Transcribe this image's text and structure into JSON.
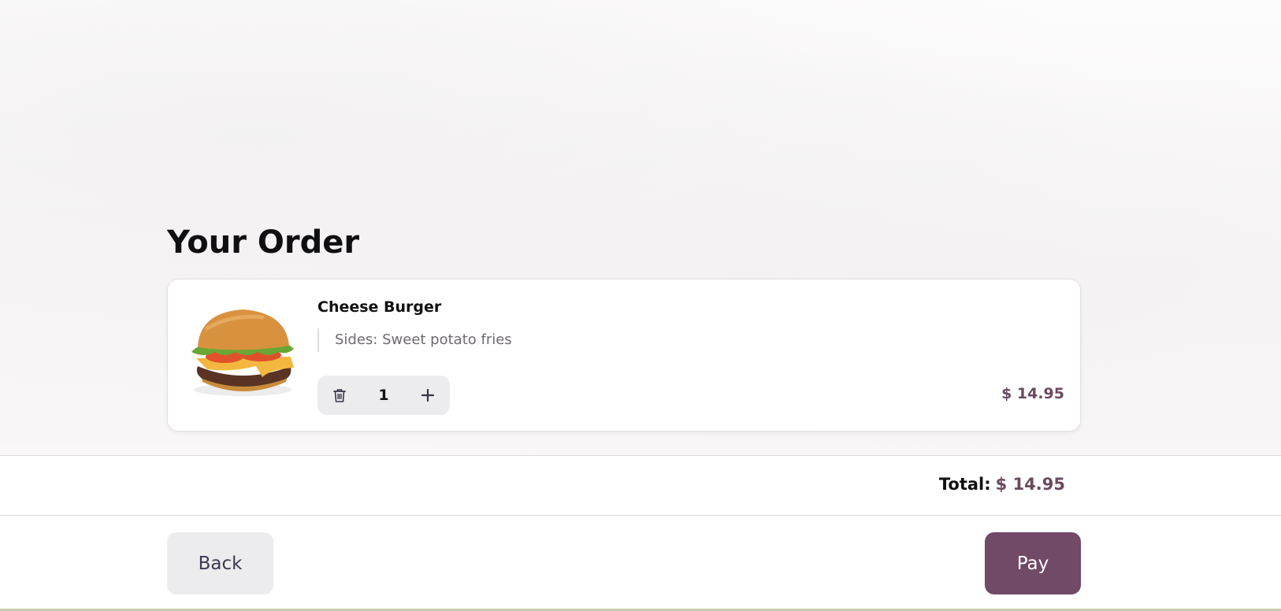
{
  "order": {
    "title": "Your Order",
    "items": [
      {
        "name": "Cheese Burger",
        "modifier": "Sides: Sweet potato fries",
        "quantity": "1",
        "price": "$ 14.95"
      }
    ]
  },
  "summary": {
    "total_label": "Total:",
    "total_value": "$ 14.95"
  },
  "actions": {
    "back_label": "Back",
    "pay_label": "Pay"
  },
  "icons": {
    "delete": "trash-icon",
    "increase": "plus-icon",
    "item_image": "cheeseburger-image"
  },
  "colors": {
    "accent": "#704a66",
    "price": "#6a4a5e",
    "secondary_button": "#ececee"
  }
}
